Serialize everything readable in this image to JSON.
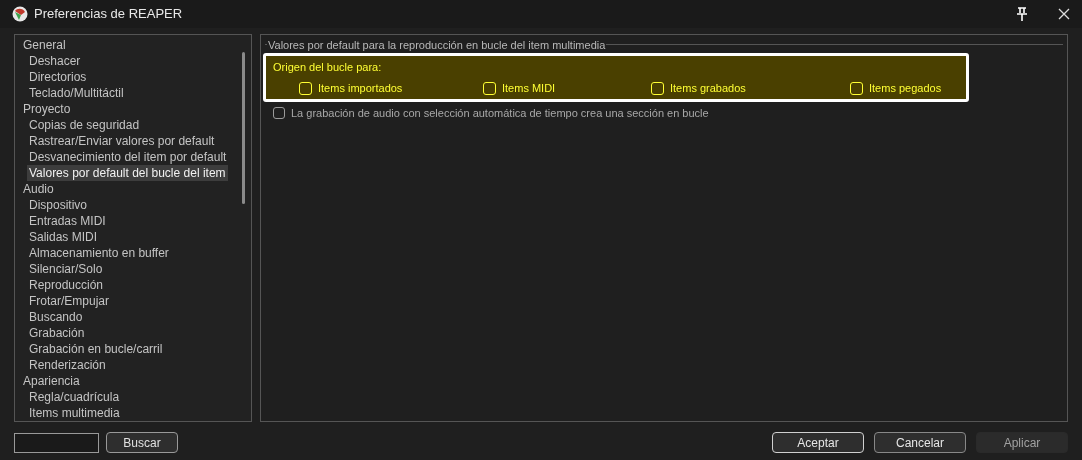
{
  "window": {
    "title": "Preferencias de REAPER"
  },
  "sidebar": {
    "items": [
      {
        "label": "General",
        "selected": false,
        "children": [
          {
            "label": "Deshacer",
            "selected": false
          },
          {
            "label": "Directorios",
            "selected": false
          },
          {
            "label": "Teclado/Multitáctil",
            "selected": false
          }
        ]
      },
      {
        "label": "Proyecto",
        "selected": false,
        "children": [
          {
            "label": "Copias de seguridad",
            "selected": false
          },
          {
            "label": "Rastrear/Enviar valores por default",
            "selected": false
          },
          {
            "label": "Desvanecimiento del item por default",
            "selected": false
          },
          {
            "label": "Valores por default del bucle del item",
            "selected": true
          }
        ]
      },
      {
        "label": "Audio",
        "selected": false,
        "children": [
          {
            "label": "Dispositivo",
            "selected": false
          },
          {
            "label": "Entradas MIDI",
            "selected": false
          },
          {
            "label": "Salidas MIDI",
            "selected": false
          },
          {
            "label": "Almacenamiento en buffer",
            "selected": false
          },
          {
            "label": "Silenciar/Solo",
            "selected": false
          },
          {
            "label": "Reproducción",
            "selected": false
          },
          {
            "label": "Frotar/Empujar",
            "selected": false
          },
          {
            "label": "Buscando",
            "selected": false
          },
          {
            "label": "Grabación",
            "selected": false
          },
          {
            "label": "Grabación en bucle/carril",
            "selected": false
          },
          {
            "label": "Renderización",
            "selected": false
          }
        ]
      },
      {
        "label": "Apariencia",
        "selected": false,
        "children": [
          {
            "label": "Regla/cuadrícula",
            "selected": false
          },
          {
            "label": "Items multimedia",
            "selected": false
          }
        ]
      }
    ]
  },
  "panel": {
    "group_title": "Valores por default para la reproducción en bucle del item multimedia",
    "highlight": {
      "label": "Origen del bucle para:",
      "checkboxes": [
        {
          "label": "Items importados",
          "checked": false
        },
        {
          "label": "Items MIDI",
          "checked": false
        },
        {
          "label": "Items grabados",
          "checked": false
        },
        {
          "label": "Items pegados",
          "checked": false
        }
      ]
    },
    "options": [
      {
        "label": "La grabación de audio con selección automática de tiempo crea una sección en bucle",
        "checked": false
      }
    ]
  },
  "search_button": "Buscar",
  "buttons": [
    {
      "label": "Aceptar",
      "disabled": false
    },
    {
      "label": "Cancelar",
      "disabled": false
    },
    {
      "label": "Aplicar",
      "disabled": true
    }
  ]
}
